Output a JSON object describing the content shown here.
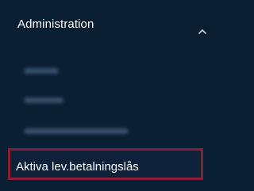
{
  "sidebar": {
    "section_title": "Administration",
    "items": [
      {
        "label": ""
      },
      {
        "label": ""
      },
      {
        "label": ""
      },
      {
        "label": "Aktiva lev.betalningslås",
        "active": true
      }
    ]
  },
  "colors": {
    "background": "#0b1f33",
    "highlight_border": "#8b1e34",
    "text": "#ffffff"
  },
  "icons": {
    "collapse": "chevron-up-icon"
  }
}
